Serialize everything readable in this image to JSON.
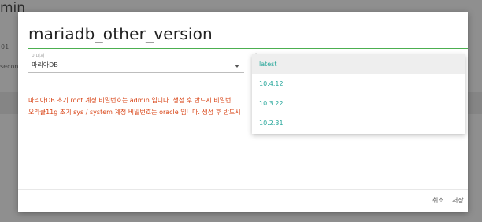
{
  "background": {
    "title_fragment": "min",
    "number_fragment": "01",
    "seconds_fragment": "secon"
  },
  "dialog": {
    "title_value": "mariadb_other_version",
    "image_field": {
      "label": "이미지",
      "value": "마리아DB"
    },
    "tag_field": {
      "label": "태그",
      "options": [
        "latest",
        "10.4.12",
        "10.3.22",
        "10.2.31"
      ],
      "highlighted": "latest"
    },
    "notices": [
      "마리아DB 초기 root 계정 비밀번호는 admin 입니다. 생성 후 반드시 비밀번",
      "오라클11g 초기 sys / system 계정 비밀번호는 oracle 입니다. 생성 후 반드시"
    ],
    "buttons": {
      "cancel": "취소",
      "save": "저장"
    }
  },
  "colors": {
    "accent_green": "#4caf50",
    "option_teal": "#26a69a",
    "notice_orange": "#d84315",
    "overlay": "#8f8f8f"
  }
}
